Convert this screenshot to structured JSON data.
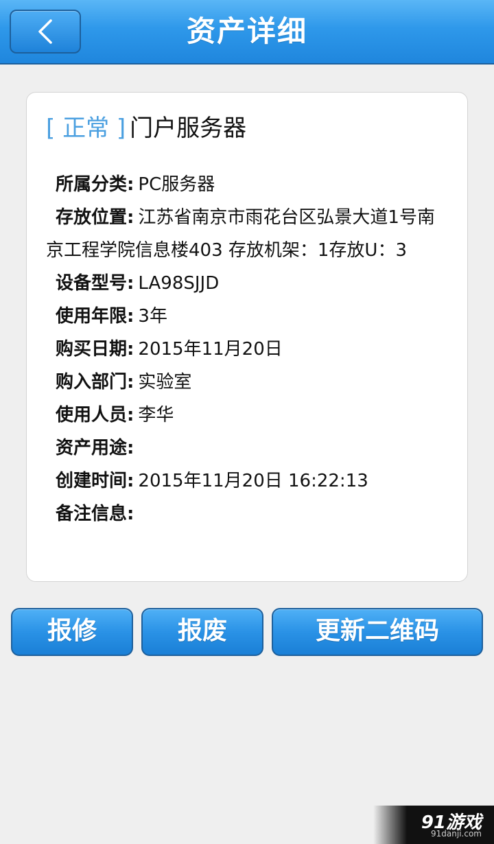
{
  "header": {
    "title": "资产详细",
    "back_icon": "chevron-left-icon"
  },
  "asset": {
    "status": "[ 正常 ]",
    "name": "门户服务器",
    "status_color": "#4a9fe0",
    "details": [
      {
        "label": "所属分类:",
        "value": "PC服务器"
      },
      {
        "label": "存放位置:",
        "value": "江苏省南京市雨花台区弘景大道1号南京工程学院信息楼403 存放机架：1存放U：3"
      },
      {
        "label": "设备型号:",
        "value": "LA98SJJD"
      },
      {
        "label": "使用年限:",
        "value": "3年"
      },
      {
        "label": "购买日期:",
        "value": "2015年11月20日"
      },
      {
        "label": "购入部门:",
        "value": "实验室"
      },
      {
        "label": "使用人员:",
        "value": "李华"
      },
      {
        "label": "资产用途:",
        "value": ""
      },
      {
        "label": "创建时间:",
        "value": "2015年11月20日 16:22:13"
      },
      {
        "label": "备注信息:",
        "value": ""
      }
    ]
  },
  "actions": {
    "repair_label": "报修",
    "scrap_label": "报废",
    "update_qr_label": "更新二维码"
  },
  "colors": {
    "header_blue": "#2e98ea",
    "button_blue": "#2a92e6",
    "background": "#efefef"
  },
  "watermark": {
    "logo": "91游戏",
    "url": "91danji.com"
  }
}
